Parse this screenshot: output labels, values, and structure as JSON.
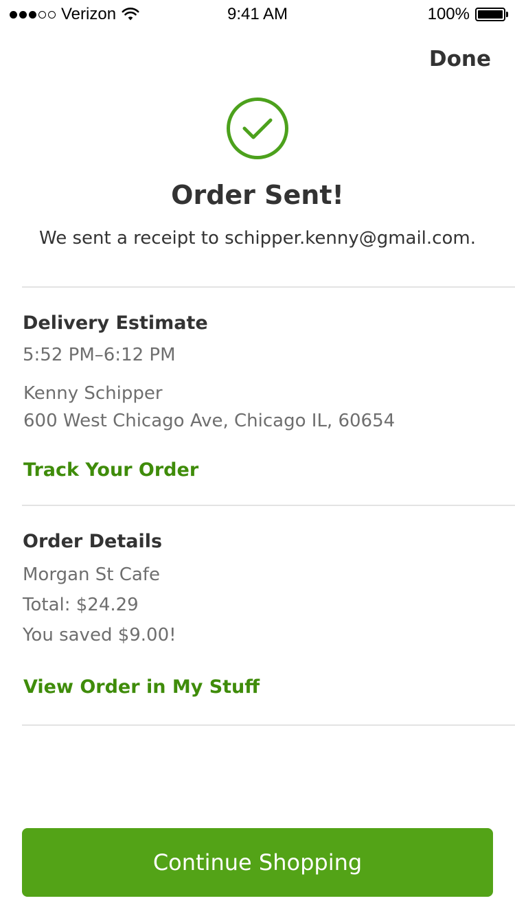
{
  "status_bar": {
    "signal": {
      "filled": 3,
      "total": 5
    },
    "carrier": "Verizon",
    "time": "9:41 AM",
    "battery_percent": "100%",
    "battery_level": 1.0
  },
  "header": {
    "done_label": "Done"
  },
  "confirmation": {
    "icon": "check-circle-icon",
    "title": "Order Sent!",
    "receipt_message": "We sent a receipt to schipper.kenny@gmail.com."
  },
  "delivery": {
    "heading": "Delivery Estimate",
    "time_window": "5:52 PM–6:12 PM",
    "recipient_name": "Kenny Schipper",
    "address": "600 West Chicago Ave, Chicago IL, 60654",
    "track_link": "Track Your Order"
  },
  "order_details": {
    "heading": "Order Details",
    "store": "Morgan St Cafe",
    "total": "Total: $24.29",
    "savings": "You saved $9.00!",
    "view_link": "View Order in My Stuff"
  },
  "footer": {
    "continue_label": "Continue Shopping"
  },
  "colors": {
    "accent_green": "#53a317",
    "link_green": "#3f8c0a",
    "icon_green": "#4ca11c",
    "text_dark": "#333333",
    "text_muted": "#6e6e6e",
    "divider": "#e3e3e3"
  }
}
